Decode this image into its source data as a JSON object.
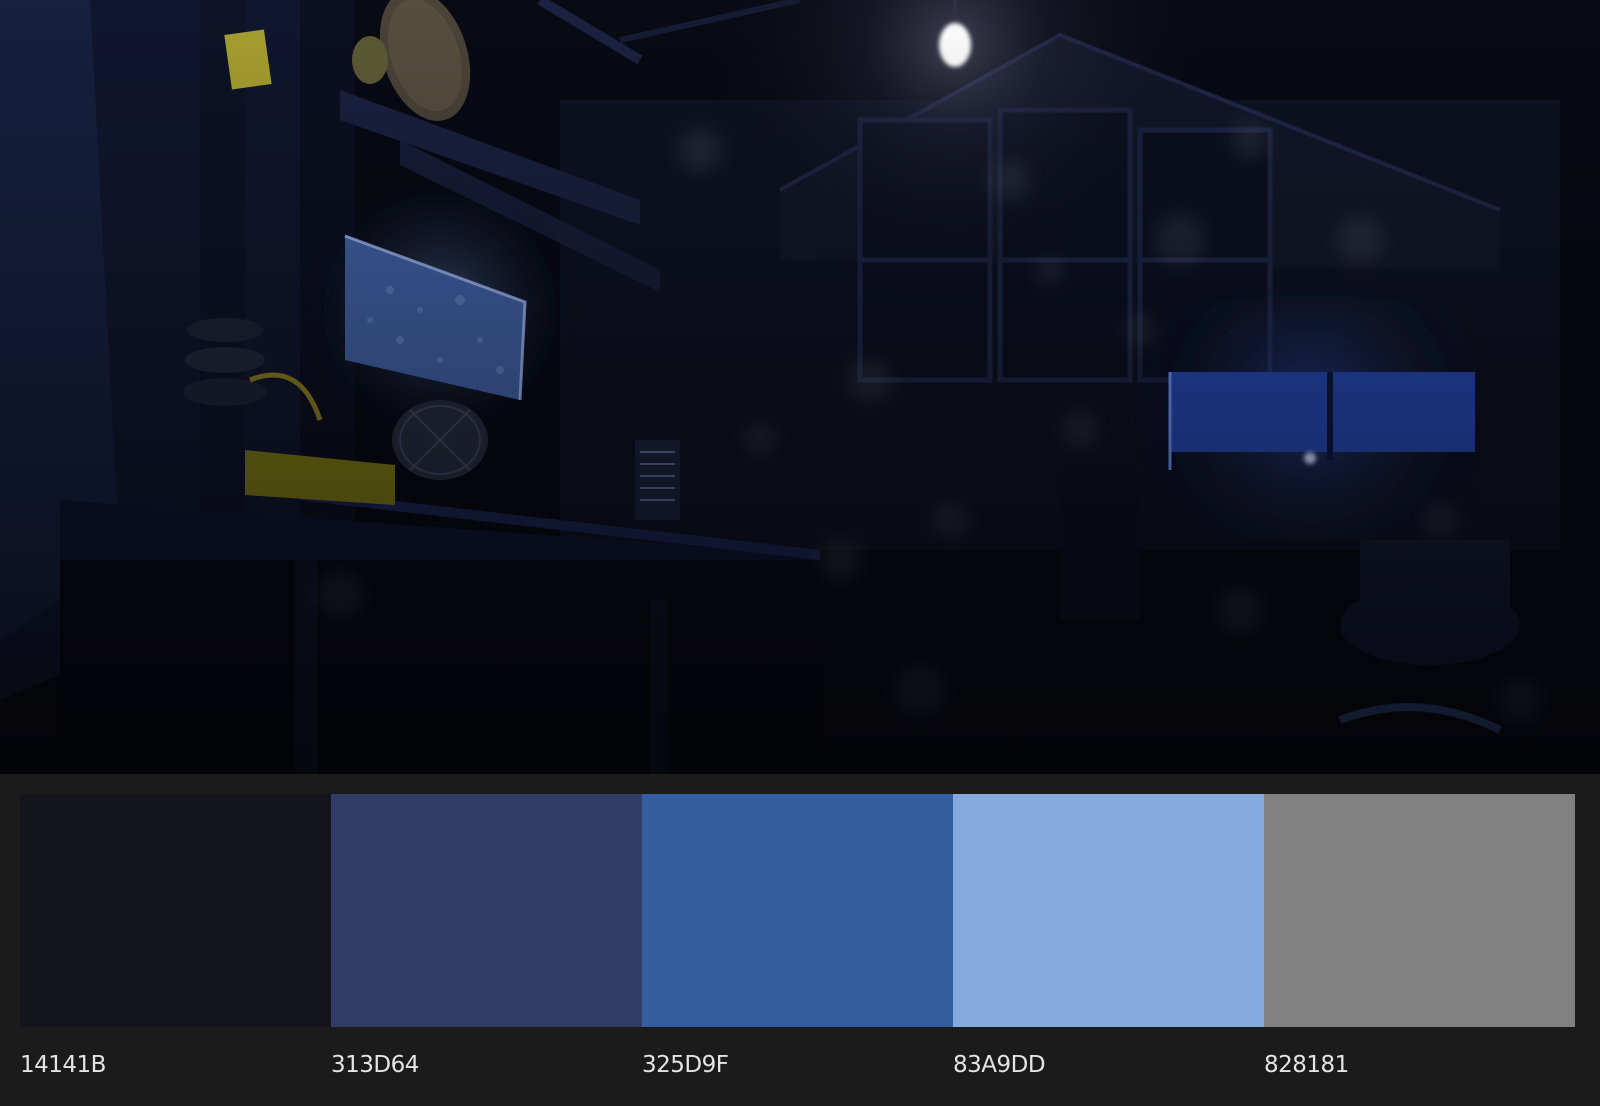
{
  "photo": {
    "scene": "dim-workshop-with-bulb",
    "accent": "#325D9F"
  },
  "palette": {
    "swatches": [
      {
        "hex": "14141B",
        "color": "#14141B"
      },
      {
        "hex": "313D64",
        "color": "#313D64"
      },
      {
        "hex": "325D9F",
        "color": "#325D9F"
      },
      {
        "hex": "83A9DD",
        "color": "#83A9DD"
      },
      {
        "hex": "828181",
        "color": "#828181"
      }
    ]
  }
}
